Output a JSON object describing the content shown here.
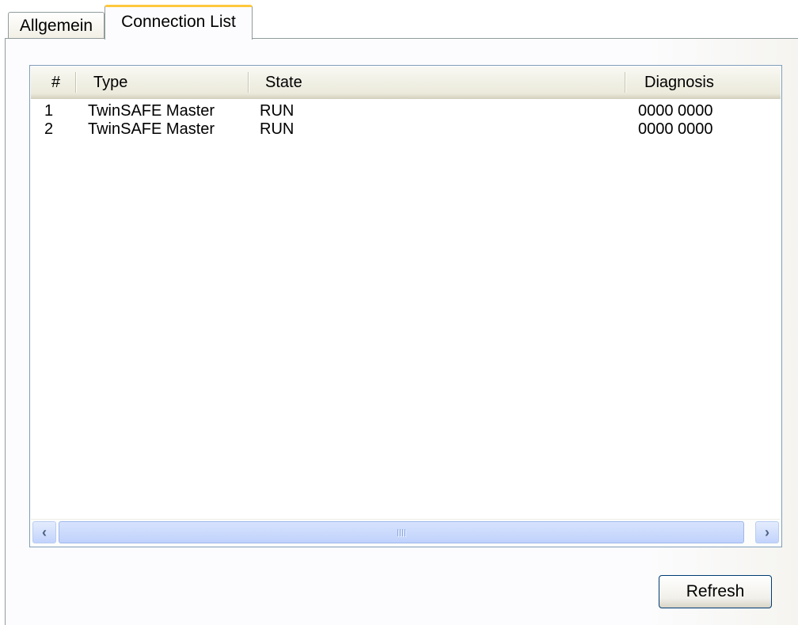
{
  "tabs": [
    {
      "label": "Allgemein",
      "active": false
    },
    {
      "label": "Connection List",
      "active": true
    }
  ],
  "list": {
    "columns": [
      "#",
      "Type",
      "State",
      "Diagnosis"
    ],
    "rows": [
      {
        "num": "1",
        "type": "TwinSAFE Master",
        "state": "RUN",
        "diagnosis": "0000 0000"
      },
      {
        "num": "2",
        "type": "TwinSAFE Master",
        "state": "RUN",
        "diagnosis": "0000 0000"
      }
    ]
  },
  "scrollbar": {
    "left_arrow": "‹",
    "right_arrow": "›"
  },
  "buttons": {
    "refresh_label": "Refresh"
  },
  "colors": {
    "active_tab_accent": "#ffc83c",
    "list_border": "#7f9db9",
    "scrollbar": "#c2d3fc",
    "button_border": "#003c74"
  }
}
